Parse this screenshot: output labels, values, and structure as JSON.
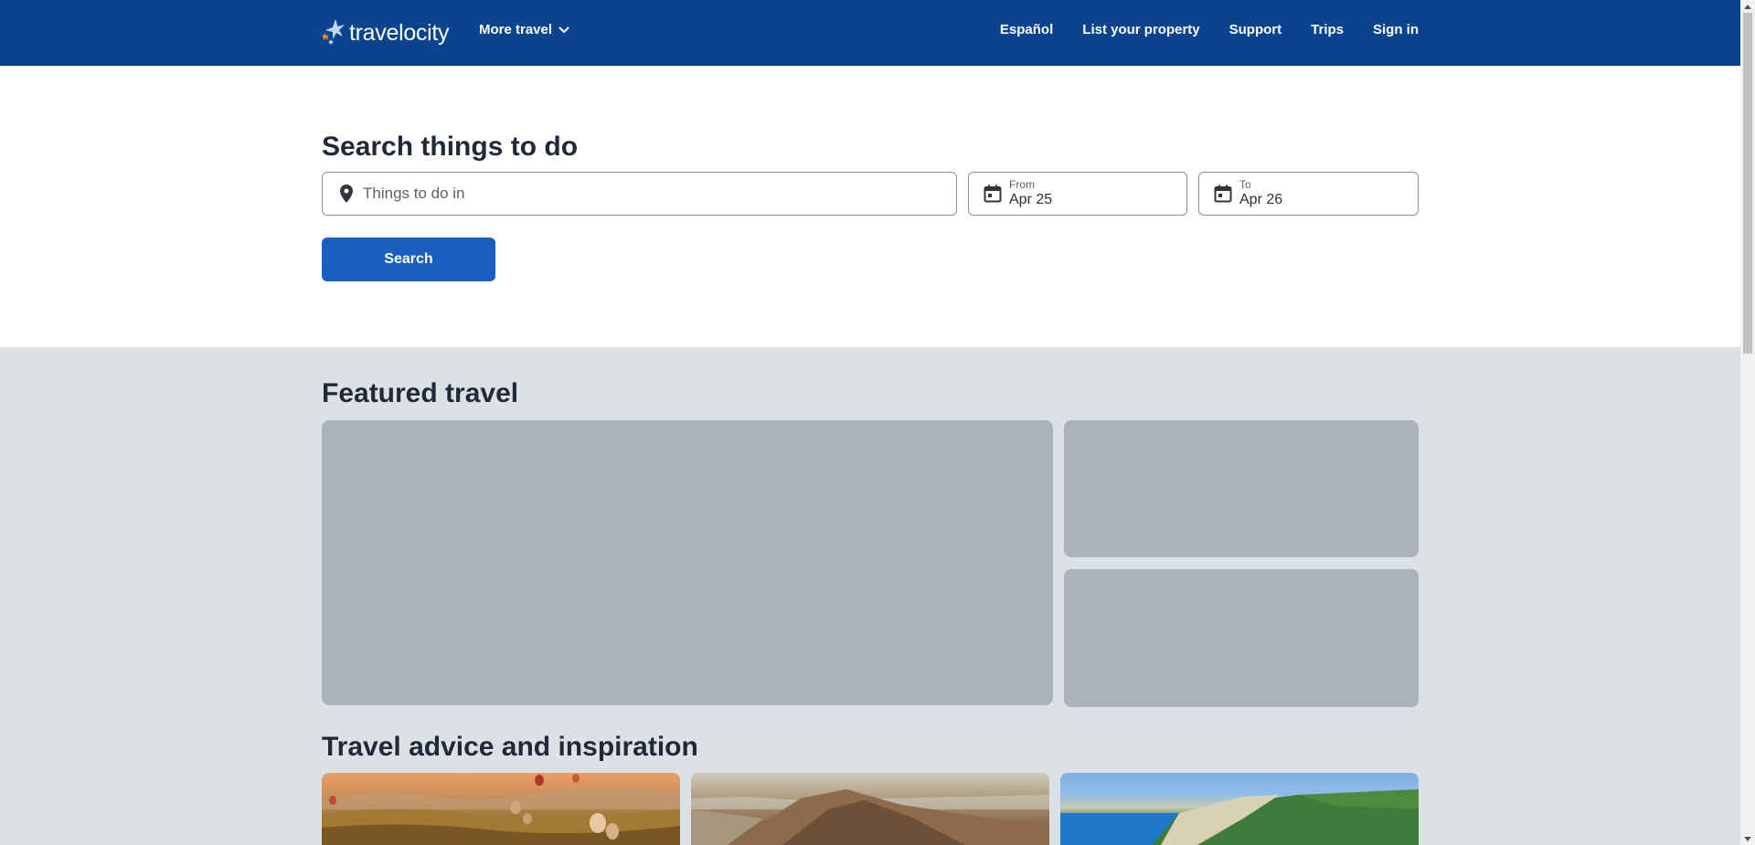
{
  "header": {
    "logo_text": "travelocity",
    "more_travel_label": "More travel",
    "nav": [
      {
        "label": "Español"
      },
      {
        "label": "List your property"
      },
      {
        "label": "Support"
      },
      {
        "label": "Trips"
      },
      {
        "label": "Sign in"
      }
    ]
  },
  "search": {
    "title": "Search things to do",
    "destination_placeholder": "Things to do in",
    "destination_value": "",
    "from_label": "From",
    "from_value": "Apr 25",
    "to_label": "To",
    "to_value": "Apr 26",
    "button_label": "Search"
  },
  "featured": {
    "title": "Featured travel"
  },
  "advice": {
    "title": "Travel advice and inspiration"
  },
  "colors": {
    "header_bg": "#0c438f",
    "accent_button": "#1a5fc0",
    "page_bg": "#dde1e5",
    "placeholder_tile": "#acb2bb"
  },
  "icons": {
    "logo": "travelocity-logo-icon",
    "chevron": "chevron-down-icon",
    "location": "map-pin-icon",
    "calendar": "calendar-icon"
  }
}
